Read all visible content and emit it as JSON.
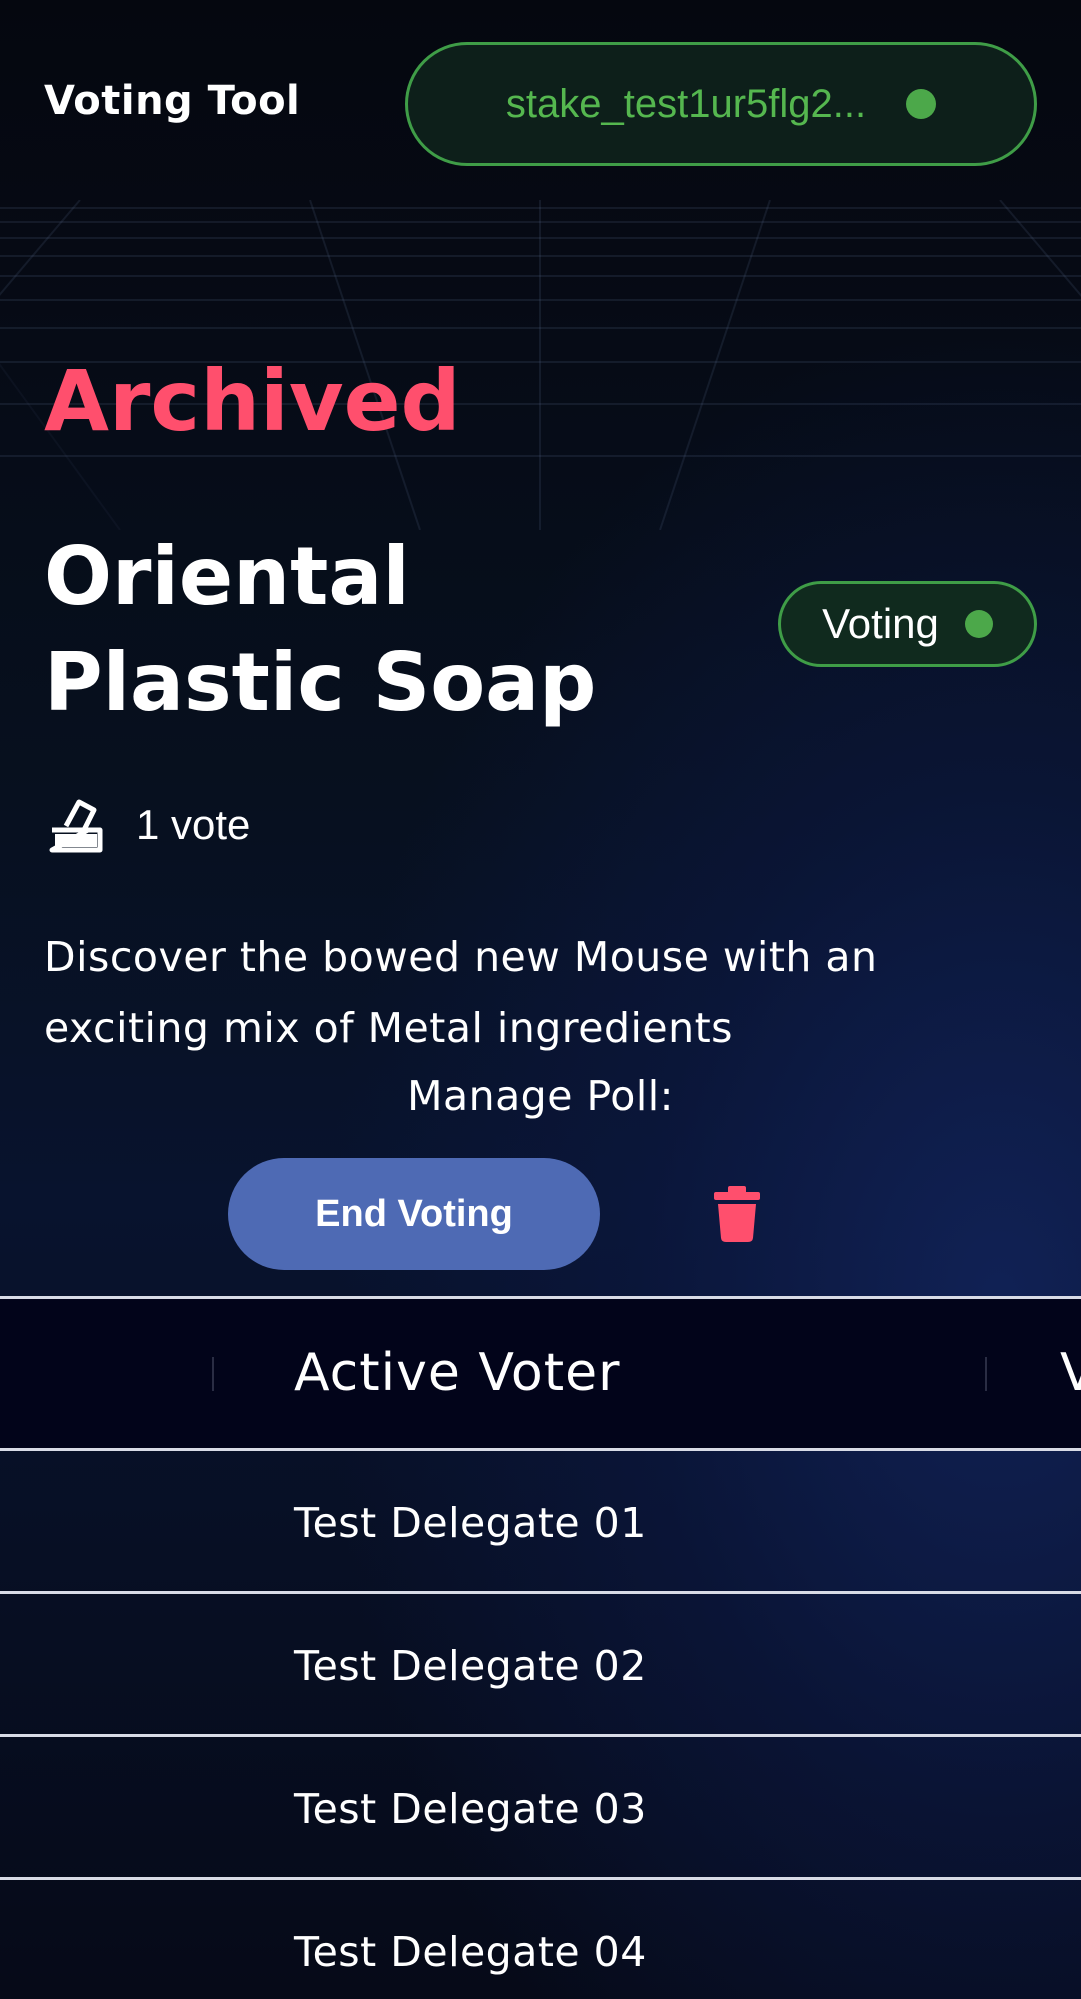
{
  "header": {
    "app_title": "Voting Tool",
    "wallet_address": "stake_test1ur5flg2...",
    "connected_color": "#4ca84a"
  },
  "poll": {
    "state_label": "Archived",
    "title": "Oriental Plastic Soap",
    "status_badge": "Voting",
    "vote_count": "1 vote",
    "description": "Discover the bowed new Mouse with an exciting mix of Metal ingredients",
    "manage_label": "Manage Poll:",
    "end_voting_label": "End Voting"
  },
  "table": {
    "columns": [
      "Active Voter",
      "V"
    ],
    "rows": [
      "Test Delegate 01",
      "Test Delegate 02",
      "Test Delegate 03",
      "Test Delegate 04"
    ]
  },
  "colors": {
    "accent_red": "#ff4f6d",
    "button_blue": "#4e6ab4",
    "success_green": "#3f9d47"
  },
  "icons": {
    "vote": "ballot-box-icon",
    "delete": "trash-icon"
  }
}
